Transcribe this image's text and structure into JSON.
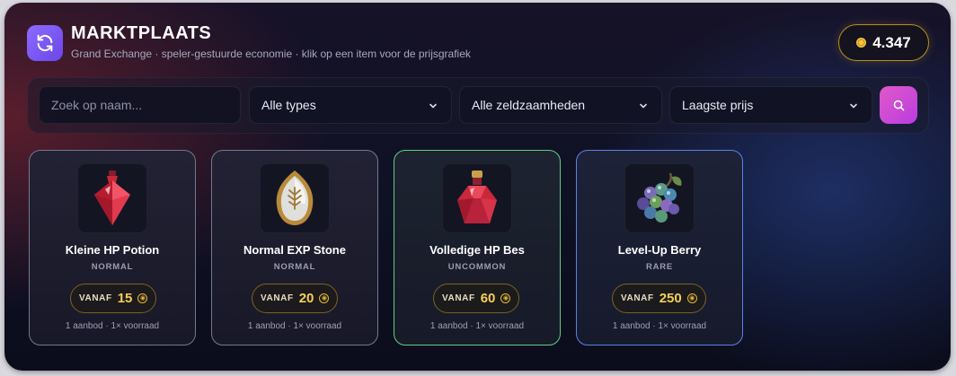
{
  "header": {
    "title": "MARKTPLAATS",
    "subtitle": "Grand Exchange · speler-gestuurde economie · klik op een item voor de prijsgrafiek",
    "logo_icon": "refresh-icon",
    "coins": "4.347"
  },
  "filters": {
    "search_placeholder": "Zoek op naam...",
    "type_label": "Alle types",
    "rarity_label": "Alle zeldzaamheden",
    "sort_label": "Laagste prijs",
    "search_button_icon": "search-icon"
  },
  "colors": {
    "accent_purple": "#7c5cf5",
    "accent_pink": "#d04ad4",
    "gold": "#f6cf57",
    "uncommon": "#5ecf86",
    "rare": "#5b82e8",
    "normal": "#74788e"
  },
  "items": [
    {
      "name": "Kleine HP Potion",
      "rarity": "NORMAL",
      "price_label": "VANAF",
      "price": "15",
      "stock": "1 aanbod · 1× voorraad",
      "icon": "red-potion-icon"
    },
    {
      "name": "Normal EXP Stone",
      "rarity": "NORMAL",
      "price_label": "VANAF",
      "price": "20",
      "stock": "1 aanbod · 1× voorraad",
      "icon": "exp-stone-icon"
    },
    {
      "name": "Volledige HP Bes",
      "rarity": "UNCOMMON",
      "price_label": "VANAF",
      "price": "60",
      "stock": "1 aanbod · 1× voorraad",
      "icon": "red-crystal-flask-icon"
    },
    {
      "name": "Level-Up Berry",
      "rarity": "RARE",
      "price_label": "VANAF",
      "price": "250",
      "stock": "1 aanbod · 1× voorraad",
      "icon": "berry-icon"
    }
  ]
}
